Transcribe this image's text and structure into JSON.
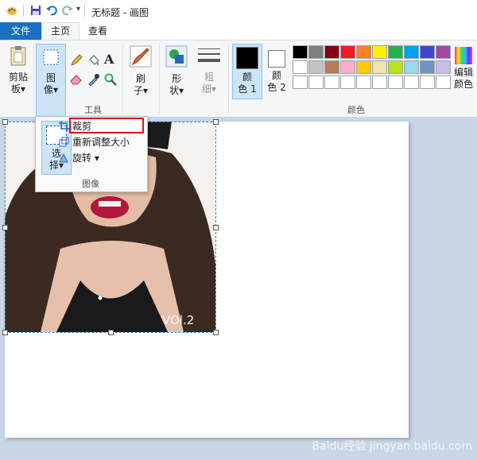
{
  "window": {
    "title": "无标题 - 画图"
  },
  "tabs": {
    "file": "文件",
    "home": "主页",
    "view": "查看"
  },
  "ribbon": {
    "clipboard": {
      "line1": "剪贴",
      "line2": "板▾"
    },
    "image": {
      "line1": "图",
      "line2": "像▾"
    },
    "tools_label": "工具",
    "brush": {
      "line1": "刷",
      "line2": "子▾"
    },
    "shapes": {
      "line1": "形",
      "line2": "状▾"
    },
    "size": {
      "line1": "粗",
      "line2": "细▾"
    },
    "color1": {
      "line1": "颜",
      "line2": "色 1"
    },
    "color2": {
      "line1": "颜",
      "line2": "色 2"
    },
    "colors_label": "颜色",
    "edit_colors": {
      "line1": "编辑",
      "line2": "颜色"
    },
    "color1_value": "#000000",
    "color2_value": "#ffffff"
  },
  "palette": {
    "row1": [
      "#000000",
      "#7f7f7f",
      "#880015",
      "#ed1c24",
      "#ff7f27",
      "#fff200",
      "#22b14c",
      "#00a2e8",
      "#3f48cc",
      "#a349a4"
    ],
    "row2": [
      "#ffffff",
      "#c3c3c3",
      "#b97a57",
      "#ffaec9",
      "#ffc90e",
      "#efe4b0",
      "#b5e61d",
      "#99d9ea",
      "#7092be",
      "#c8bfe7"
    ],
    "row3": [
      "#ffffff",
      "#ffffff",
      "#ffffff",
      "#ffffff",
      "#ffffff",
      "#ffffff",
      "#ffffff",
      "#ffffff",
      "#ffffff",
      "#ffffff"
    ]
  },
  "image_menu": {
    "select": {
      "line1": "选",
      "line2": "择▾"
    },
    "crop": "裁剪",
    "resize": "重新调整大小",
    "rotate": "旋转 ▾",
    "group_label": "图像"
  },
  "photo": {
    "caption": "VOl.2"
  },
  "watermark": "Baidu经验 jingyan.baidu.com"
}
